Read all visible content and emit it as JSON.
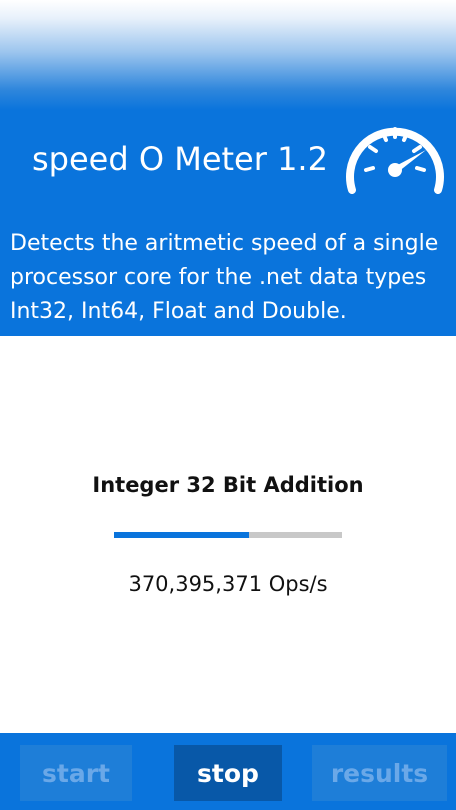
{
  "header": {
    "title": "speed O Meter 1.2",
    "description": "Detects the aritmetic speed of a single processor core for the .net data types Int32, Int64, Float and Double.",
    "icon": "speedometer-icon"
  },
  "test": {
    "name": "Integer 32 Bit Addition",
    "progress_fraction": 0.59,
    "result": "370,395,371 Ops/s"
  },
  "buttons": {
    "start": "start",
    "stop": "stop",
    "results": "results"
  },
  "colors": {
    "accent": "#0a74dc",
    "active_button": "#0858a8",
    "disabled_text": "#6aa8e8",
    "progress_track": "#c8c8c8"
  }
}
